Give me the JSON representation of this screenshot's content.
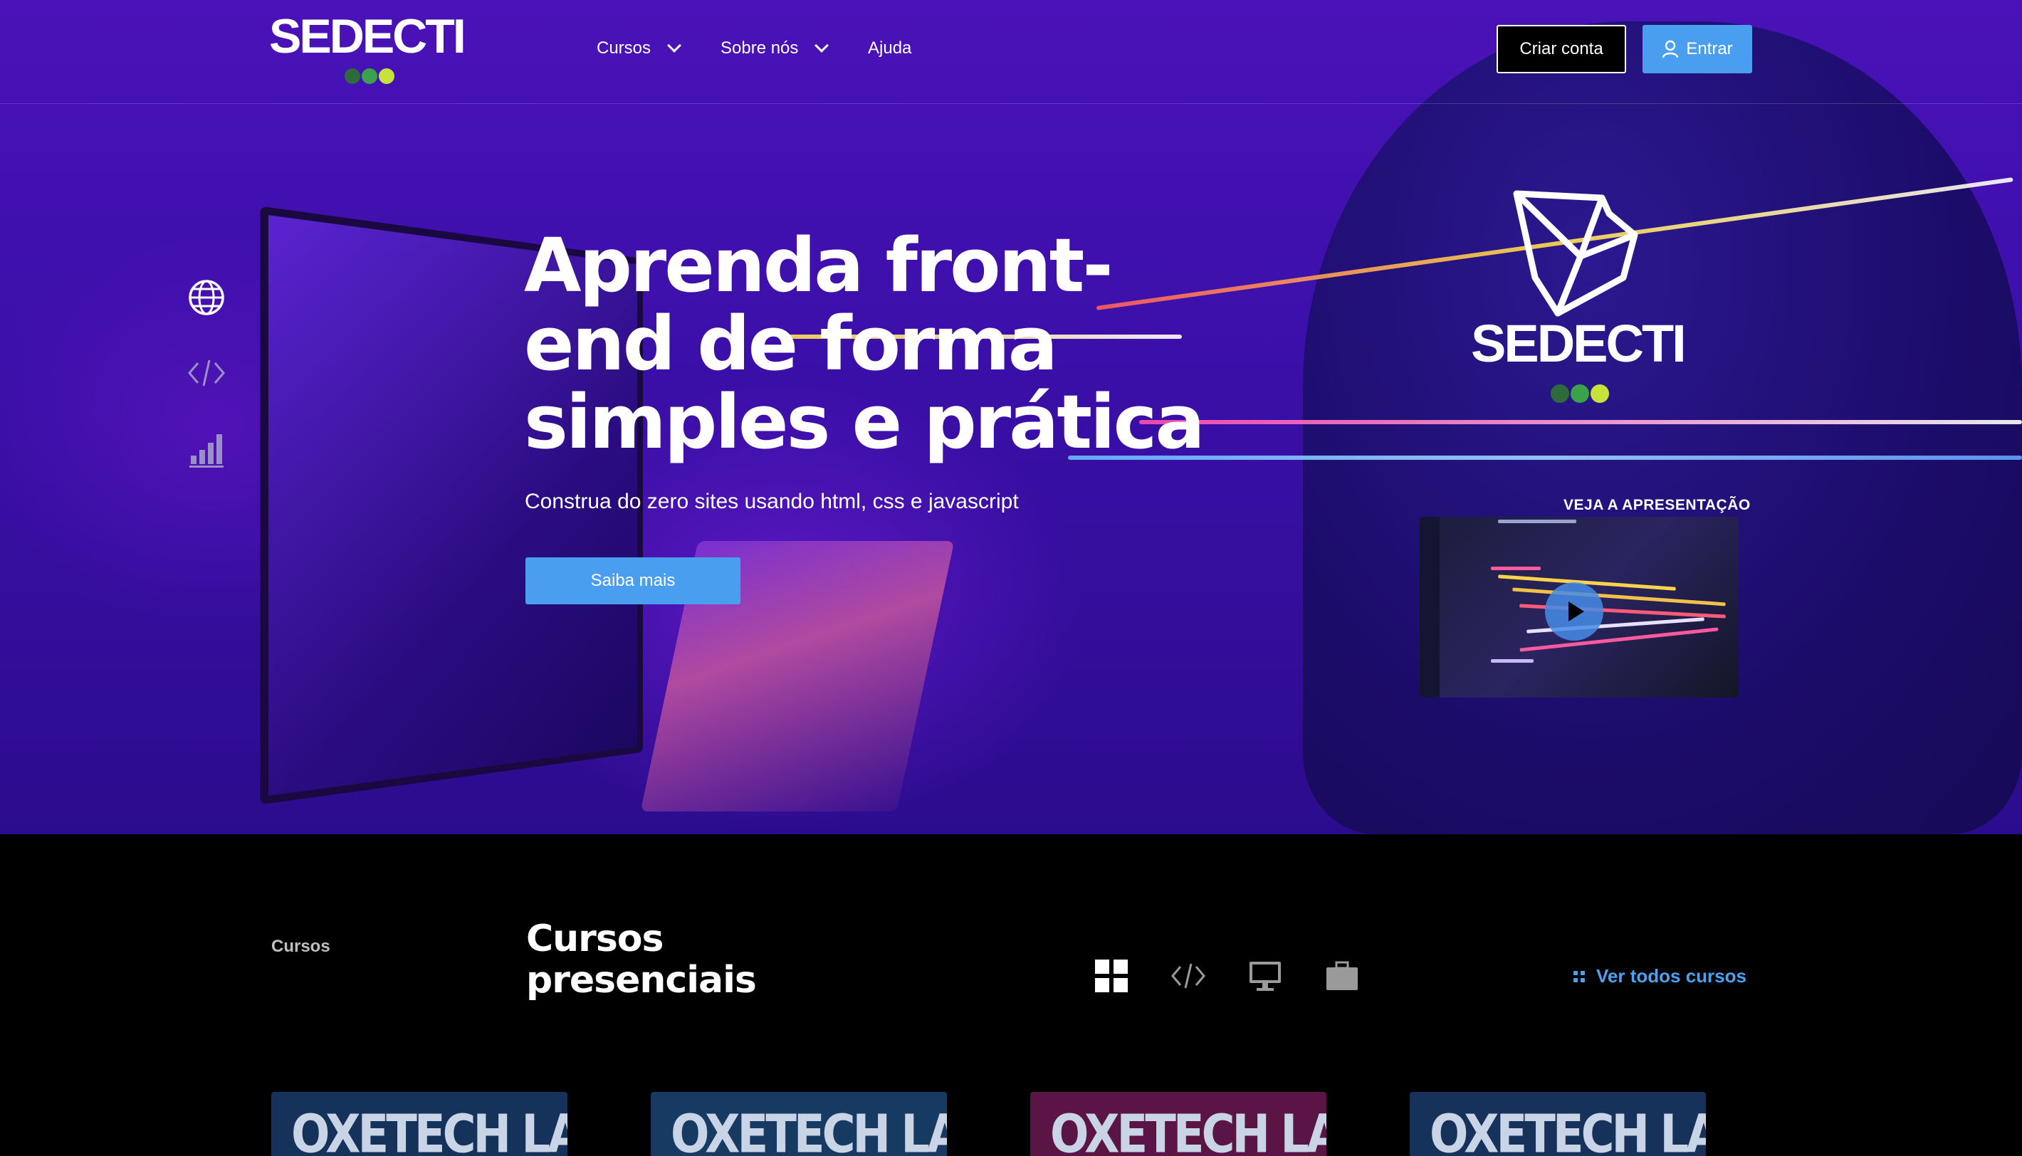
{
  "header": {
    "logo_text": "SEDECTI",
    "nav": [
      {
        "label": "Cursos",
        "has_dropdown": true
      },
      {
        "label": "Sobre nós",
        "has_dropdown": true
      },
      {
        "label": "Ajuda",
        "has_dropdown": false
      }
    ],
    "create_account_label": "Criar conta",
    "login_label": "Entrar",
    "login_icon": "user-icon"
  },
  "hero": {
    "title": "Aprenda front-end de forma simples e prática",
    "subtitle": "Construa do zero sites usando html, css e javascript",
    "cta_label": "Saiba mais",
    "side_icons": [
      "globe-icon",
      "code-icon",
      "bar-chart-icon"
    ],
    "brand_text": "SEDECTI",
    "video_label": "VEJA A APRESENTAÇÃO",
    "video_icon": "play-icon"
  },
  "courses": {
    "section_tag": "Cursos",
    "title": "Cursos presenciais",
    "filters": [
      "grid-icon",
      "code-icon",
      "monitor-icon",
      "briefcase-icon"
    ],
    "see_all_label": "Ver todos cursos",
    "cards": [
      {
        "title": "OXETECH LAB",
        "color": "#14325a"
      },
      {
        "title": "OXETECH LAB",
        "color": "#173a63"
      },
      {
        "title": "OXETECH LAB",
        "color": "#5a1546"
      },
      {
        "title": "OXETECH LAB",
        "color": "#16315a"
      }
    ]
  },
  "colors": {
    "accent": "#4a9ef0",
    "link": "#4aa3f2",
    "logo_dots": [
      "#2e6b3c",
      "#3aa24a",
      "#c7e23a"
    ]
  }
}
